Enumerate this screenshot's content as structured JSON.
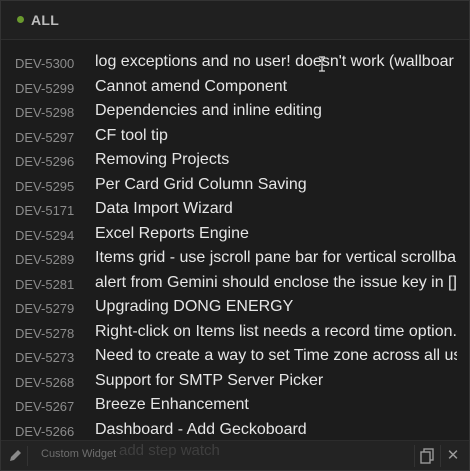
{
  "header": {
    "filter_label": "ALL",
    "status_color": "#6a9a2e"
  },
  "items": [
    {
      "key": "DEV-5300",
      "title": "log exceptions and no user! doesn't work (wallboar"
    },
    {
      "key": "DEV-5299",
      "title": "Cannot amend Component"
    },
    {
      "key": "DEV-5298",
      "title": "Dependencies and inline editing"
    },
    {
      "key": "DEV-5297",
      "title": "CF tool tip"
    },
    {
      "key": "DEV-5296",
      "title": "Removing Projects"
    },
    {
      "key": "DEV-5295",
      "title": "Per Card Grid Column Saving"
    },
    {
      "key": "DEV-5171",
      "title": "Data Import Wizard"
    },
    {
      "key": "DEV-5294",
      "title": "Excel Reports Engine"
    },
    {
      "key": "DEV-5289",
      "title": "Items grid - use jscroll pane bar for vertical scrollba"
    },
    {
      "key": "DEV-5281",
      "title": "alert from Gemini should enclose the issue key in []"
    },
    {
      "key": "DEV-5279",
      "title": "Upgrading DONG ENERGY"
    },
    {
      "key": "DEV-5278",
      "title": "Right-click on Items list needs a record time option."
    },
    {
      "key": "DEV-5273",
      "title": "Need to create a way to set Time zone across all us"
    },
    {
      "key": "DEV-5268",
      "title": "Support for SMTP Server Picker"
    },
    {
      "key": "DEV-5267",
      "title": "Breeze Enhancement"
    },
    {
      "key": "DEV-5266",
      "title": "Dashboard - Add Geckoboard"
    }
  ],
  "footer": {
    "label": "Custom Widget",
    "ghost_text": "add step watch",
    "edit_icon": "pencil-icon",
    "copy_icon": "copy-icon",
    "close_icon": "close-icon",
    "close_glyph": "✕"
  }
}
